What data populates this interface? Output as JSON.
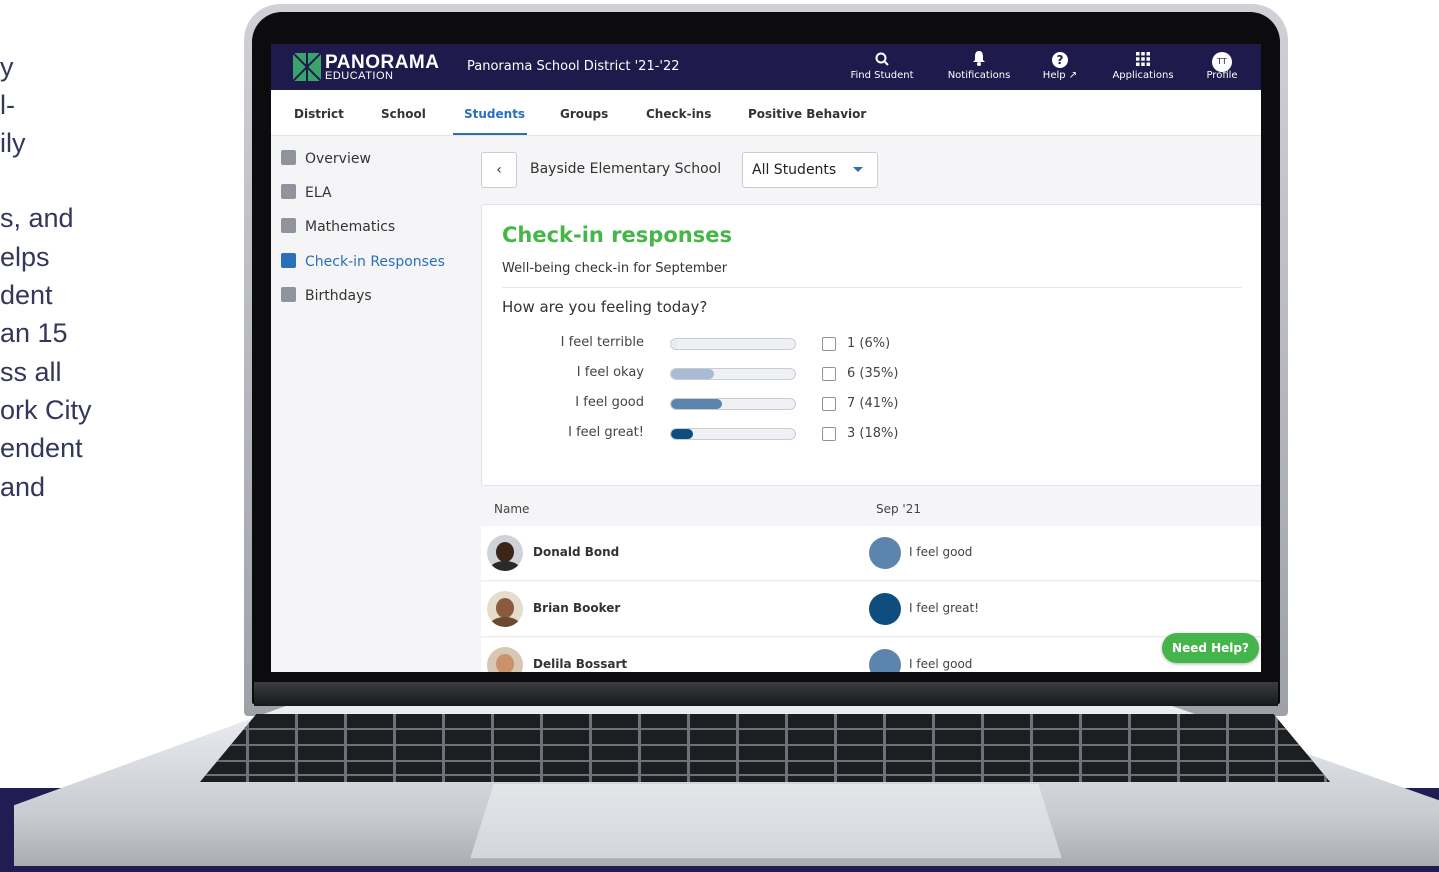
{
  "marketing_text": [
    "y",
    "l-",
    "ily",
    "",
    "s, and",
    "elps",
    "dent",
    "an 15",
    "ss all",
    "ork City",
    "endent",
    "and"
  ],
  "header": {
    "brand": "PANORAMA",
    "brand_sub": "EDUCATION",
    "district": "Panorama School District '21-'22",
    "nav": [
      {
        "label": "Find Student",
        "icon": "search-icon"
      },
      {
        "label": "Notifications",
        "icon": "bell-icon"
      },
      {
        "label": "Help",
        "icon": "help-icon"
      },
      {
        "label": "Applications",
        "icon": "grid-icon"
      },
      {
        "label": "Profile",
        "icon": "avatar-icon",
        "initials": "TT"
      }
    ]
  },
  "tabs": [
    {
      "label": "District"
    },
    {
      "label": "School"
    },
    {
      "label": "Students",
      "active": true
    },
    {
      "label": "Groups"
    },
    {
      "label": "Check-ins"
    },
    {
      "label": "Positive Behavior"
    }
  ],
  "sidebar": {
    "items": [
      {
        "label": "Overview",
        "icon": "overview-icon"
      },
      {
        "label": "ELA",
        "icon": "book-icon"
      },
      {
        "label": "Mathematics",
        "icon": "calculator-icon"
      },
      {
        "label": "Check-in Responses",
        "icon": "chart-icon",
        "active": true
      },
      {
        "label": "Birthdays",
        "icon": "cake-icon"
      }
    ]
  },
  "filters": {
    "back": "‹",
    "school": "Bayside Elementary School",
    "group_select": "All Students"
  },
  "card": {
    "title": "Check-in responses",
    "subtitle": "Well-being check-in for September",
    "question": "How are you feeling today?",
    "responses": [
      {
        "label": "I feel terrible",
        "count": "1 (6%)",
        "fraction": 0.06,
        "color": "#e8ebf0"
      },
      {
        "label": "I feel okay",
        "count": "6 (35%)",
        "fraction": 0.35,
        "color": "#a9bbd2"
      },
      {
        "label": "I feel good",
        "count": "7 (41%)",
        "fraction": 0.41,
        "color": "#5b85ad"
      },
      {
        "label": "I feel great!",
        "count": "3 (18%)",
        "fraction": 0.18,
        "color": "#0e4d7e"
      }
    ]
  },
  "table": {
    "col_name": "Name",
    "col_month": "Sep '21",
    "rows": [
      {
        "name": "Donald Bond",
        "response": "I feel good",
        "color": "#5b85ad"
      },
      {
        "name": "Brian Booker",
        "response": "I feel great!",
        "color": "#0e4d7e"
      },
      {
        "name": "Delila Bossart",
        "response": "I feel good",
        "color": "#5b85ad"
      }
    ]
  },
  "need_help": "Need Help?",
  "colors": {
    "navy": "#1e1a4c",
    "accent_blue": "#2a6fba",
    "green": "#46b648"
  }
}
